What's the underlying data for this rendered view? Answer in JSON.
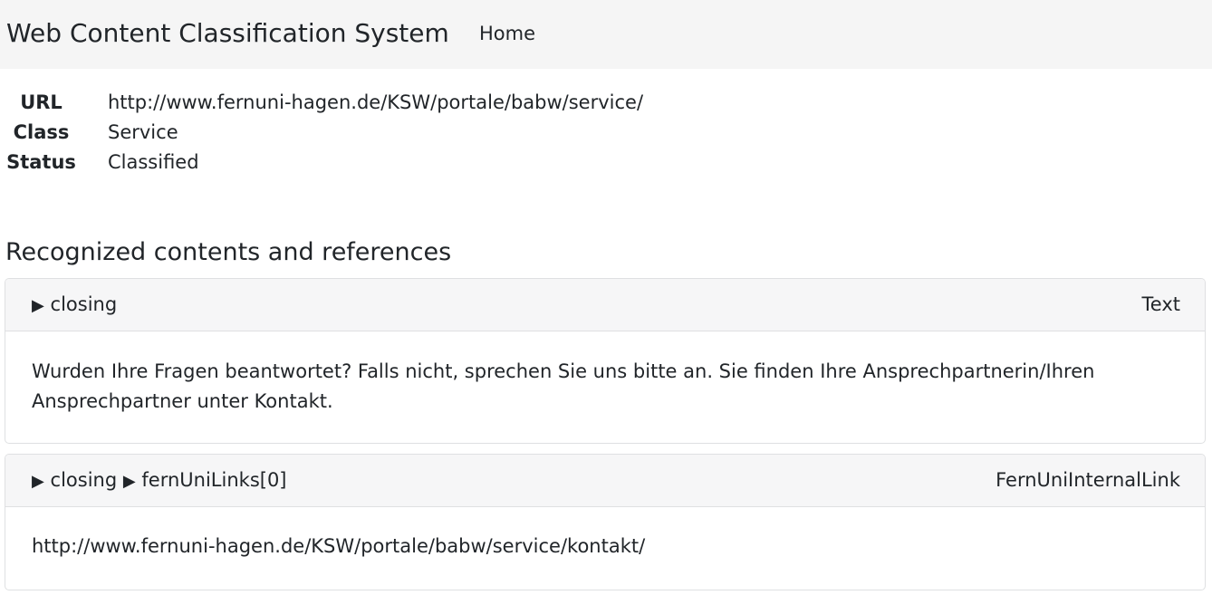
{
  "navbar": {
    "brand": "Web Content Classification System",
    "home_label": "Home"
  },
  "meta": {
    "url_key": "URL",
    "url_value": "http://www.fernuni-hagen.de/KSW/portale/babw/service/",
    "class_key": "Class",
    "class_value": "Service",
    "status_key": "Status",
    "status_value": "Classified"
  },
  "section_title": "Recognized contents and references",
  "cards": [
    {
      "arrow1": "▶",
      "seg1": "closing",
      "arrow2": "",
      "seg2": "",
      "type": "Text",
      "body": "Wurden Ihre Fragen beantwortet? Falls nicht, sprechen Sie uns bitte an. Sie finden Ihre Ansprechpartnerin/Ihren Ansprechpartner unter Kontakt."
    },
    {
      "arrow1": "▶",
      "seg1": "closing",
      "arrow2": "▶",
      "seg2": "fernUniLinks[0]",
      "type": "FernUniInternalLink",
      "body": "http://www.fernuni-hagen.de/KSW/portale/babw/service/kontakt/"
    }
  ]
}
